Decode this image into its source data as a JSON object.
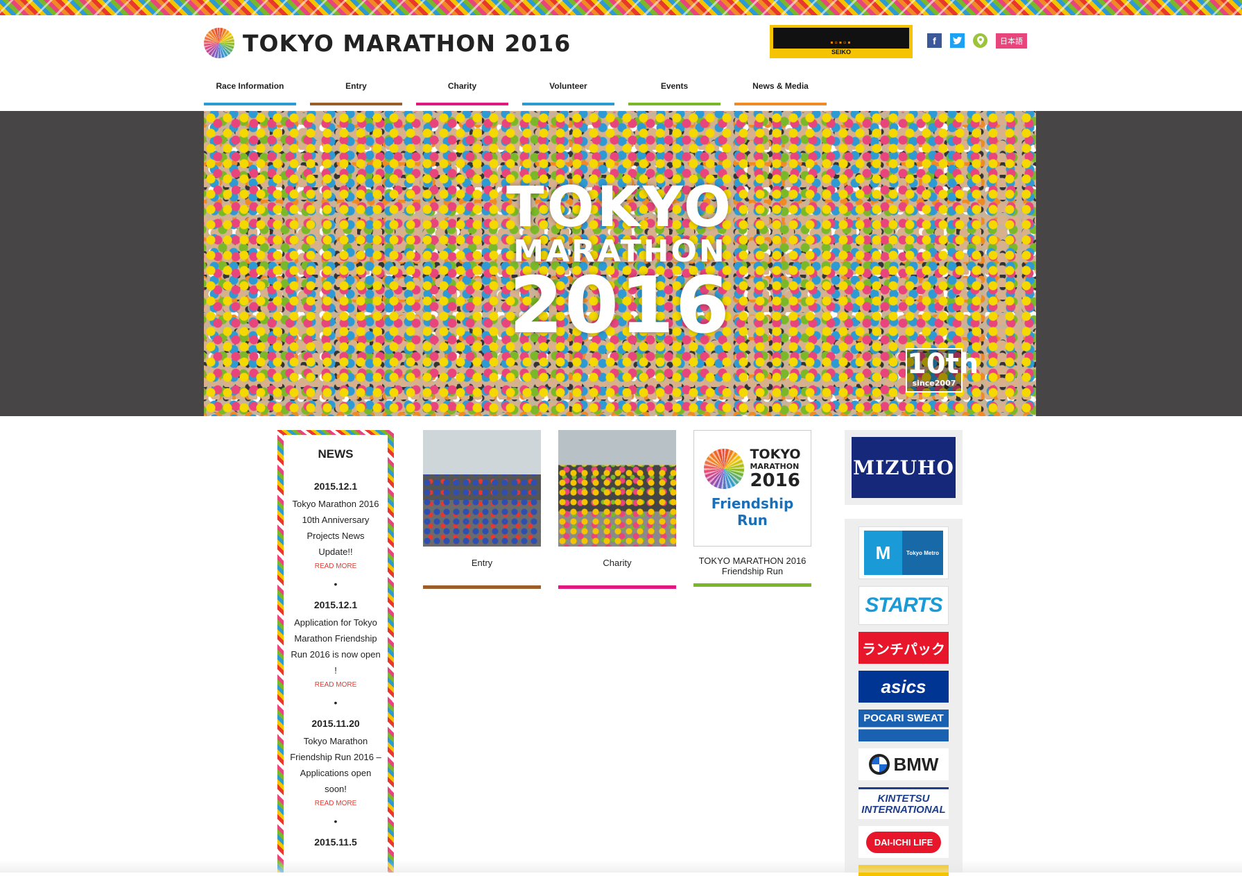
{
  "header": {
    "logo_text": "TOKYO MARATHON 2016",
    "sponsor_badge": {
      "brand": "SEIKO"
    },
    "social": [
      {
        "name": "facebook",
        "glyph": "f"
      },
      {
        "name": "twitter",
        "glyph": "t"
      },
      {
        "name": "map",
        "glyph": "•"
      }
    ],
    "language_button": "日本語"
  },
  "nav": {
    "items": [
      {
        "label": "Race Information",
        "color": "#2e9ad4"
      },
      {
        "label": "Entry",
        "color": "#9b5e2a"
      },
      {
        "label": "Charity",
        "color": "#e0187f"
      },
      {
        "label": "Volunteer",
        "color": "#2e9ad4"
      },
      {
        "label": "Events",
        "color": "#7ab829"
      },
      {
        "label": "News & Media",
        "color": "#f08a24"
      }
    ]
  },
  "hero": {
    "line1": "TOKYO",
    "line2": "MARATHON",
    "line3": "2016",
    "badge_number": "10th",
    "badge_since": "since2007"
  },
  "news": {
    "title": "NEWS",
    "read_more": "READ MORE",
    "separator": "•",
    "entries": [
      {
        "date": "2015.12.1",
        "text": "Tokyo Marathon 2016 10th Anniversary Projects News Update!!"
      },
      {
        "date": "2015.12.1",
        "text": "Application for Tokyo Marathon Friendship Run 2016 is now open !"
      },
      {
        "date": "2015.11.20",
        "text": "Tokyo Marathon Friendship Run 2016 – Applications open soon!"
      },
      {
        "date": "2015.11.5",
        "text": ""
      }
    ]
  },
  "cards": [
    {
      "label": "Entry",
      "color": "#9b5e2a"
    },
    {
      "label": "Charity",
      "color": "#e0187f"
    },
    {
      "label": "TOKYO MARATHON 2016 Friendship Run",
      "color": "#7ab829",
      "logo_line1": "TOKYO",
      "logo_line2": "MARATHON",
      "logo_line3": "2016",
      "logo_run": "Friendship Run"
    }
  ],
  "sponsors": {
    "top": "MIZUHO",
    "list": [
      {
        "name": "Tokyo Metro",
        "glyph": "M"
      },
      {
        "name": "STARTS"
      },
      {
        "name": "ランチパック"
      },
      {
        "name": "asics"
      },
      {
        "name": "POCARI SWEAT"
      },
      {
        "name": "BMW"
      },
      {
        "name": "KINTETSU INTERNATIONAL"
      },
      {
        "name": "DAI-ICHI LIFE"
      }
    ]
  }
}
